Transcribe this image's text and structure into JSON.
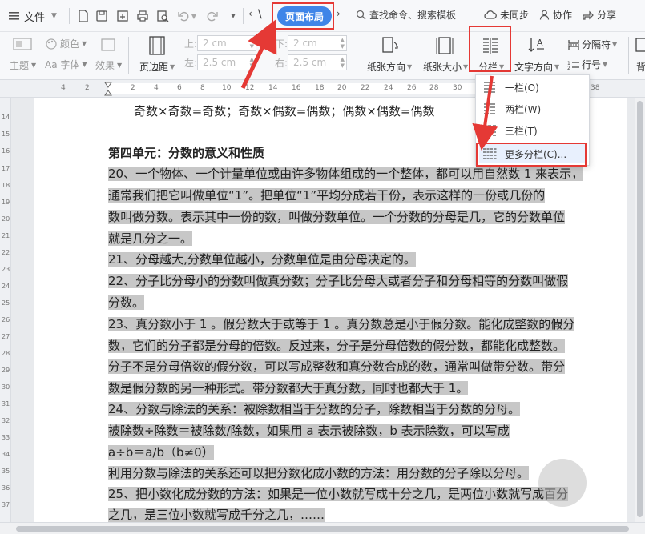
{
  "topbar": {
    "file_label": "文件",
    "active_tab": "页面布局",
    "search_label": "查找命令、搜索模板",
    "sync_label": "未同步",
    "collab_label": "协作",
    "share_label": "分享"
  },
  "ribbon": {
    "theme_label": "主题",
    "color_label": "颜色",
    "font_label": "Aa 字体",
    "effect_label": "效果",
    "margin_label": "页边距",
    "top_label": "上:",
    "bottom_label": "下:",
    "left_label": "左:",
    "right_label": "右:",
    "top_value": "2 cm",
    "bottom_value": "2 cm",
    "left_value": "2.5 cm",
    "right_value": "2.5 cm",
    "orientation_label": "纸张方向",
    "size_label": "纸张大小",
    "columns_label": "分栏",
    "text_dir_label": "文字方向",
    "separator_label": "分隔符",
    "line_num_label": "行号",
    "bg_label": "背"
  },
  "dropdown": {
    "items": [
      {
        "label": "一栏(O)"
      },
      {
        "label": "两栏(W)"
      },
      {
        "label": "三栏(T)"
      },
      {
        "label": "更多分栏(C)..."
      }
    ]
  },
  "ruler": {
    "ticks": [
      "4",
      "2",
      "2",
      "4",
      "6",
      "8",
      "10",
      "12",
      "14",
      "16",
      "18",
      "20",
      "22",
      "24",
      "26",
      "28",
      "30",
      "32",
      "34",
      "36",
      "38"
    ],
    "vticks": [
      "14",
      "15",
      "16",
      "17",
      "18",
      "19",
      "20",
      "21",
      "22",
      "23",
      "24",
      "25",
      "26",
      "27",
      "28",
      "29",
      "30",
      "31",
      "32",
      "33",
      "34",
      "35",
      "36",
      "37",
      "38"
    ]
  },
  "document": {
    "first_line": "奇数×奇数=奇数；奇数×偶数=偶数；偶数×偶数=偶数",
    "heading": "第四单元：分数的意义和性质",
    "lines": [
      "20、一个物体、一个计量单位或由许多物体组成的一个整体，都可以用自然数 1 来表示，",
      "通常我们把它叫做单位“1”。把单位“1”平均分成若干份，表示这样的一份或几份的",
      "数叫做分数。表示其中一份的数，叫做分数单位。一个分数的分母是几，它的分数单位",
      "就是几分之一。",
      "21、分母越大,分数单位越小，分数单位是由分母决定的。",
      "22、分子比分母小的分数叫做真分数；分子比分母大或者分子和分母相等的分数叫做假",
      "分数。",
      "23、真分数小于 1 。假分数大于或等于 1 。真分数总是小于假分数。能化成整数的假分",
      "数，它们的分子都是分母的倍数。反过来，分子是分母倍数的假分数，都能化成整数。",
      "分子不是分母倍数的假分数，可以写成整数和真分数合成的数，通常叫做带分数。带分",
      "数是假分数的另一种形式。带分数都大于真分数，同时也都大于 1。",
      "24、分数与除法的关系：被除数相当于分数的分子，除数相当于分数的分母。",
      "被除数÷除数＝被除数/除数，如果用 a 表示被除数，b 表示除数，可以写成",
      "a÷b＝a/b（b≠0）",
      "利用分数与除法的关系还可以把分数化成小数的方法：用分数的分子除以分母。",
      "25、把小数化成分数的方法：如果是一位小数就写成十分之几，是两位小数就写成百分",
      "之几，是三位小数就写成千分之几，……"
    ]
  }
}
